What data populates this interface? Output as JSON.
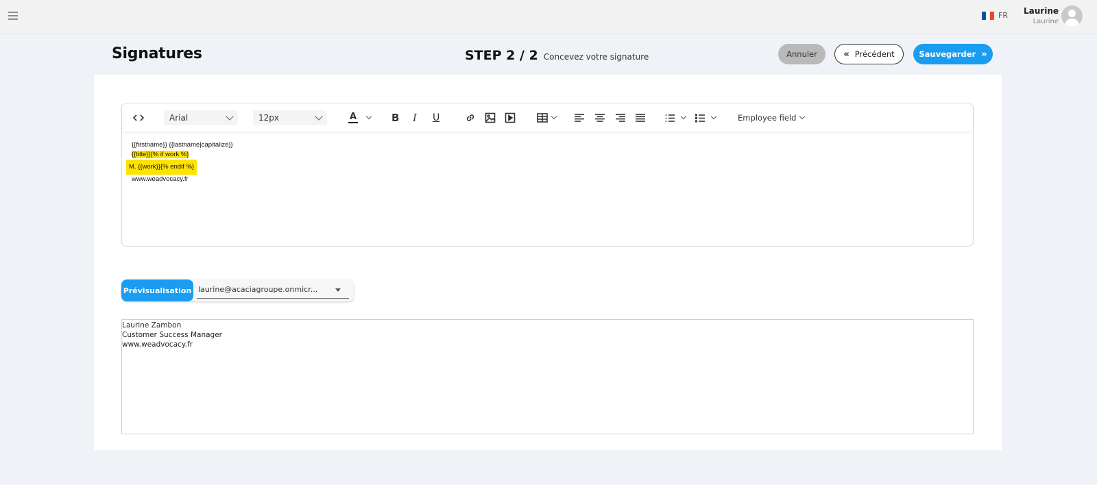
{
  "header": {
    "lang_code": "FR",
    "user_name": "Laurine",
    "user_sub": "Laurine",
    "flag_colors": [
      "#0055a4",
      "#ffffff",
      "#ef4135"
    ]
  },
  "page": {
    "title": "Signatures",
    "step": "STEP 2 / 2",
    "step_desc": "Concevez votre signature"
  },
  "actions": {
    "cancel": "Annuler",
    "previous": "Précédent",
    "save": "Sauvegarder",
    "accent": "#1a9cf0"
  },
  "toolbar": {
    "font": "Arial",
    "size": "12px",
    "bold": "B",
    "italic": "I",
    "underline": "U",
    "text_color": "A",
    "employee_field": "Employee field"
  },
  "editor": {
    "line1": "{{firstname}} {{lastname|capitalize}}",
    "line2a": "{{title}}",
    "line2b": "{% if work %}",
    "line3": "M. {{work}}{% endif %}",
    "line4": "www.weadvocacy.fr"
  },
  "preview": {
    "button": "Prévisualisation",
    "email": "laurine@acaciagroupe.onmicr...",
    "lines": [
      "Laurine Zambon",
      "Customer Success Manager",
      "www.weadvocacy.fr"
    ]
  }
}
